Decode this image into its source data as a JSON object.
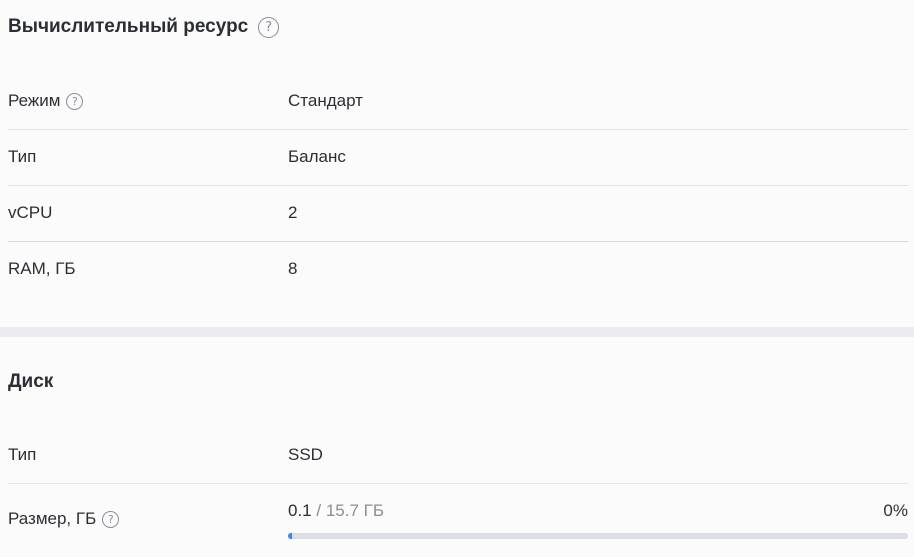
{
  "compute": {
    "title": "Вычислительный ресурс",
    "help_icon": "question-circle-icon",
    "rows": [
      {
        "label": "Режим",
        "value": "Стандарт",
        "has_help": true
      },
      {
        "label": "Тип",
        "value": "Баланс"
      },
      {
        "label": "vCPU",
        "value": "2"
      },
      {
        "label": "RAM, ГБ",
        "value": "8"
      }
    ]
  },
  "disk": {
    "title": "Диск",
    "rows": [
      {
        "label": "Тип",
        "value": "SSD"
      },
      {
        "label": "Размер, ГБ",
        "has_help": true
      }
    ],
    "size": {
      "used": "0.1",
      "separator": " / ",
      "total": "15.7 ГБ",
      "percent_label": "0%",
      "fill_fraction": 0.006
    }
  },
  "colors": {
    "text": "#2b2e33",
    "muted": "#8a8e96",
    "accent": "#3b82f6",
    "track": "#dcdee6"
  }
}
